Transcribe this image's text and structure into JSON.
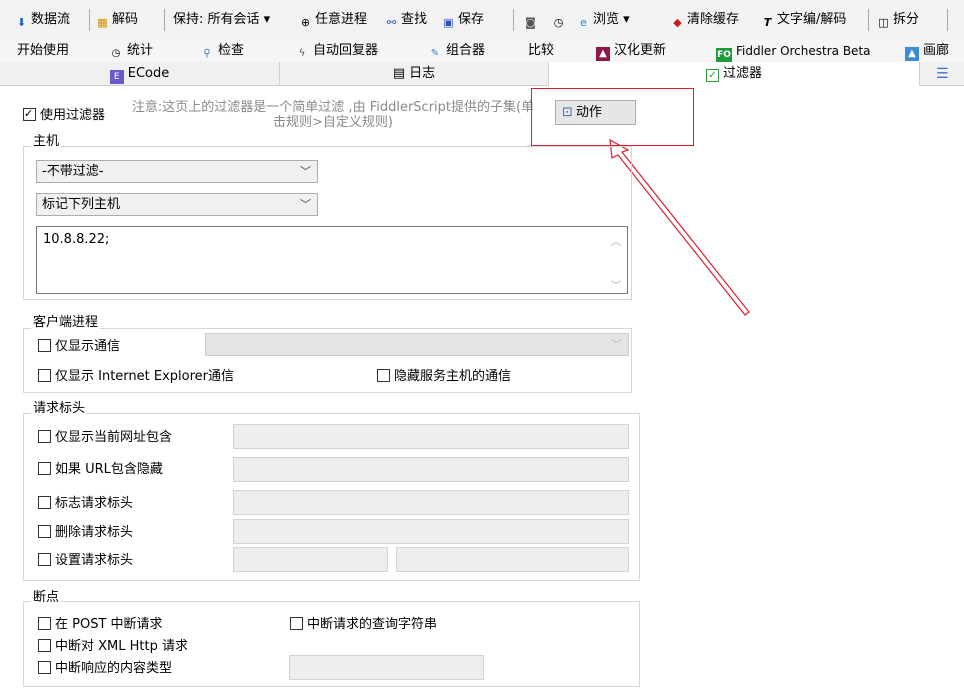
{
  "toolbar": {
    "stream": "数据流",
    "decode": "解码",
    "keep": "保持: 所有会话 ▾",
    "process": "任意进程",
    "find": "查找",
    "save": "保存",
    "browse": "浏览 ▾",
    "clear_cache": "清除缓存",
    "text_encode": "文字编/解码",
    "split": "拆分"
  },
  "tabs_row1": {
    "start": "开始使用",
    "stats": "统计",
    "inspect": "检查",
    "autoresponder": "自动回复器",
    "composer": "组合器",
    "compare": "比较",
    "chinese_update": "汉化更新",
    "orchestra_badge": "FO",
    "orchestra": "Fiddler Orchestra Beta",
    "gallery": "画廊"
  },
  "tabs_row2": {
    "ecode": "ECode",
    "log": "日志",
    "filters": "过滤器"
  },
  "filters": {
    "use_filters": "使用过滤器",
    "note": "注意:这页上的过滤器是一个简单过滤 ,由 FiddlerScript提供的子集(单击规则>自定义规则)",
    "action_button": "动作",
    "hosts": {
      "title": "主机",
      "select1": "-不带过滤-",
      "select2": "标记下列主机",
      "hosts_text": "10.8.8.22;"
    },
    "client_process": {
      "title": "客户端进程",
      "only_show_traffic": "仅显示通信",
      "only_show_ie": "仅显示 Internet Explorer通信",
      "hide_service_host": "隐藏服务主机的通信"
    },
    "request_headers": {
      "title": "请求标头",
      "url_contains": "仅显示当前网址包含",
      "hide_if_url": "如果 URL包含隐藏",
      "flag_header": "标志请求标头",
      "delete_header": "删除请求标头",
      "set_header": "设置请求标头"
    },
    "breakpoints": {
      "title": "断点",
      "break_post": "在 POST 中断请求",
      "break_query": "中断请求的查询字符串",
      "break_xhr": "中断对 XML Http 请求",
      "break_response_type": "中断响应的内容类型"
    }
  },
  "colors": {
    "annotation_red": "#d9212c",
    "checkbox_green": "#2e9e3a"
  }
}
